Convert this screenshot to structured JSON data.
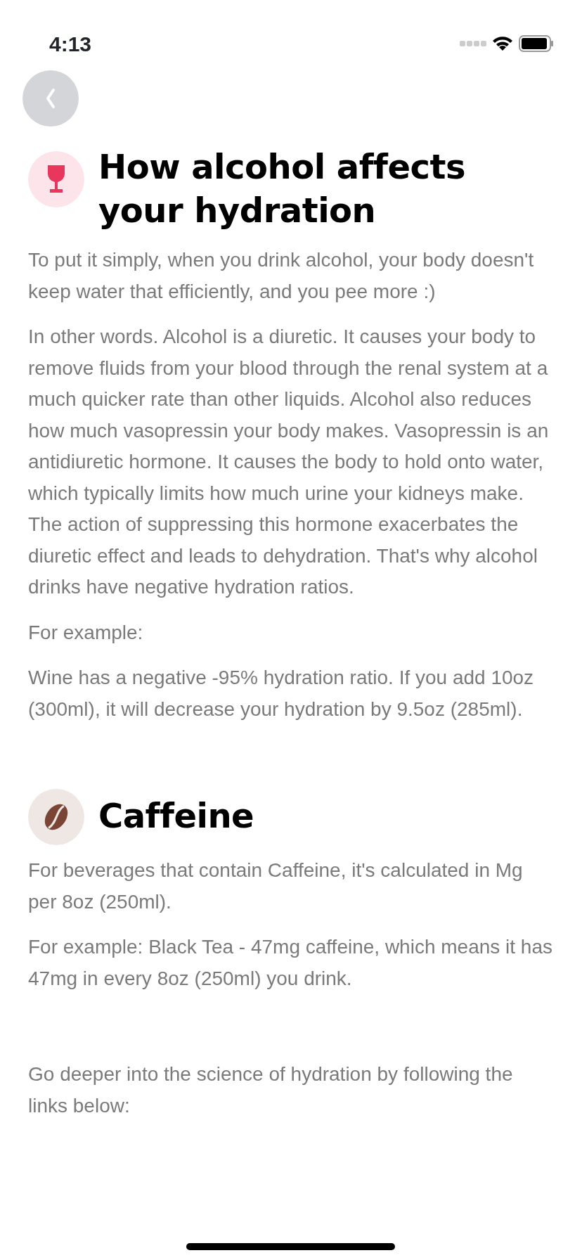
{
  "status_bar": {
    "time": "4:13"
  },
  "sections": [
    {
      "kind": "alcohol",
      "title": "How alcohol affects your hydration",
      "paragraphs": [
        "To put it simply, when you drink alcohol, your body doesn't keep water that efficiently, and you pee more :)",
        "In other words. Alcohol is a diuretic. It causes your body to remove fluids from your blood through the renal system at a much quicker rate than other liquids. Alcohol also reduces how much vasopressin your body makes. Vasopressin is an antidiuretic hormone. It causes the body to hold onto water, which typically limits how much urine your kidneys make. The action of suppressing this hormone exacerbates the diuretic effect and leads to dehydration. That's why alcohol drinks have negative hydration ratios.",
        "For example:",
        "Wine has a negative -95% hydration ratio. If you add 10oz (300ml), it will decrease your hydration by 9.5oz (285ml)."
      ]
    },
    {
      "kind": "caffeine",
      "title": "Caffeine",
      "paragraphs": [
        "For beverages that contain Caffeine, it's calculated in Mg per 8oz (250ml).",
        "For example: Black Tea - 47mg caffeine, which means it has 47mg in every 8oz (250ml) you drink."
      ]
    }
  ],
  "footer_text": "Go deeper into the science of hydration by following the links below:"
}
